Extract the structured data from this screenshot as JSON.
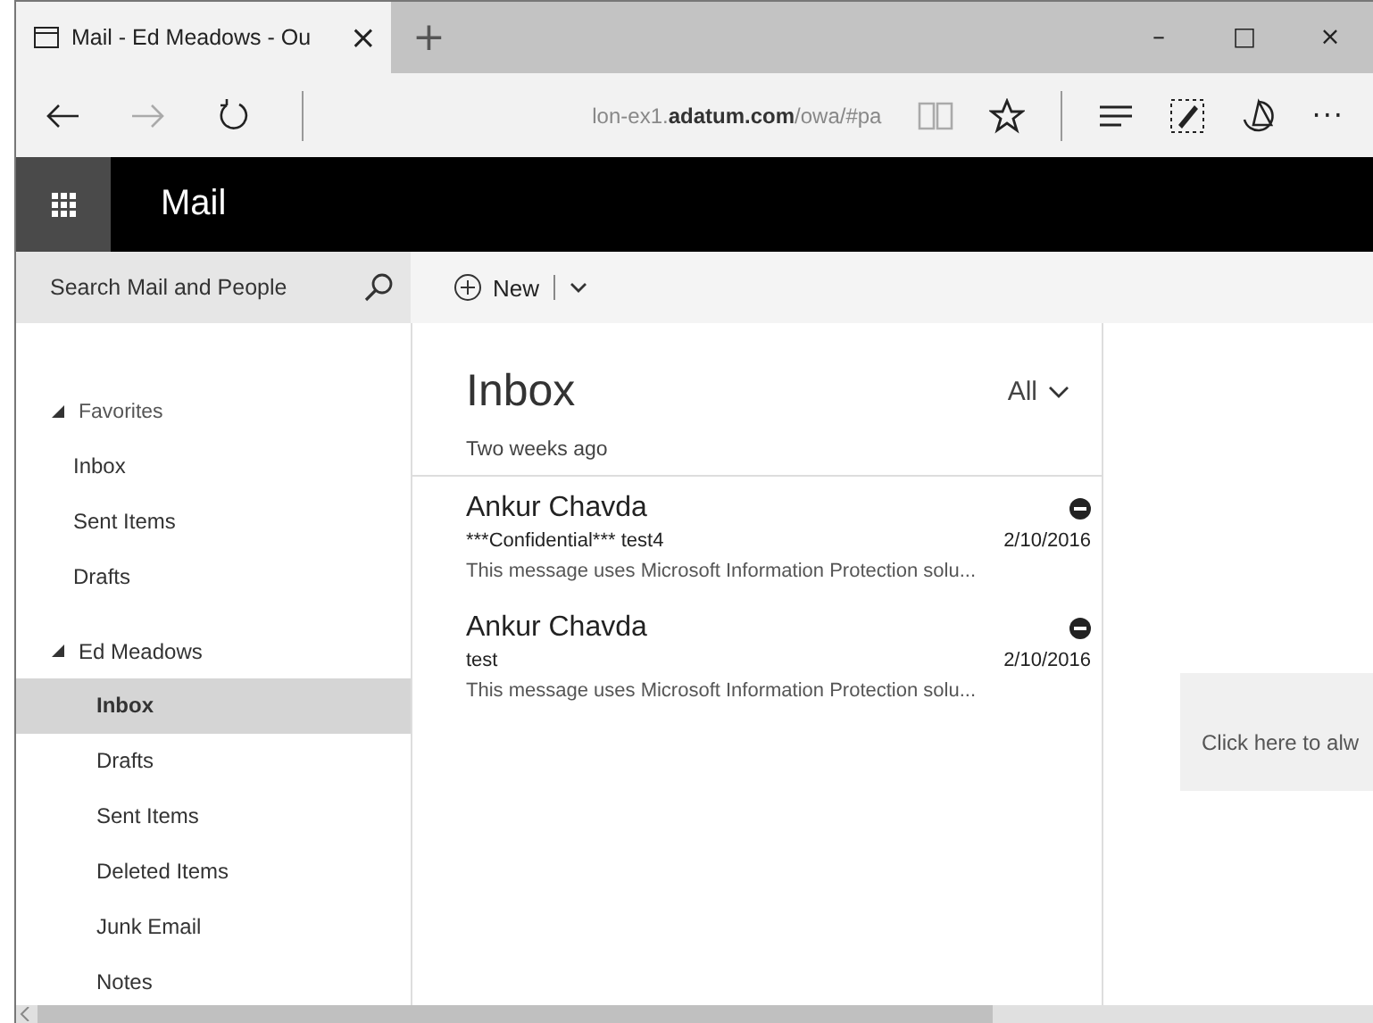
{
  "browser": {
    "tab": {
      "title": "Mail - Ed Meadows - Ou",
      "close": "×",
      "selected": true
    },
    "new_tab": "+",
    "window_controls": [
      "–",
      "□",
      "×"
    ],
    "address": "lon-ex1.**adatum.com**/owa/#pa",
    "more": "···"
  },
  "app_bar": {
    "title": "Mail"
  },
  "search": {
    "placeholder": "Search Mail and People"
  },
  "new_button": {
    "label": "New"
  },
  "sidebar": {
    "sections": [
      {
        "label": "Favorites",
        "expanded": true,
        "children": [
          {
            "label": "Inbox",
            "selected": false
          },
          {
            "label": "Sent Items",
            "selected": false
          },
          {
            "label": "Drafts",
            "selected": false
          }
        ]
      },
      {
        "label": "Ed Meadows",
        "expanded": true,
        "children": [
          {
            "label": "Inbox",
            "selected": true
          },
          {
            "label": "Drafts",
            "selected": false
          },
          {
            "label": "Sent Items",
            "selected": false
          },
          {
            "label": "Deleted Items",
            "selected": false
          },
          {
            "label": "Junk Email",
            "selected": false
          },
          {
            "label": "Notes",
            "selected": false
          }
        ]
      }
    ]
  },
  "message_list": {
    "title": "Inbox",
    "filter": "All",
    "group": "Two weeks ago",
    "messages": [
      {
        "sender": "Ankur Chavda",
        "subject": "***Confidential*** test4",
        "date": "2/10/2016",
        "preview": "This message uses Microsoft Information Protection solu..."
      },
      {
        "sender": "Ankur Chavda",
        "subject": "test",
        "date": "2/10/2016",
        "preview": "This message uses Microsoft Information Protection solu..."
      }
    ]
  },
  "reading_pane": {
    "notice": "Click here to alw"
  }
}
